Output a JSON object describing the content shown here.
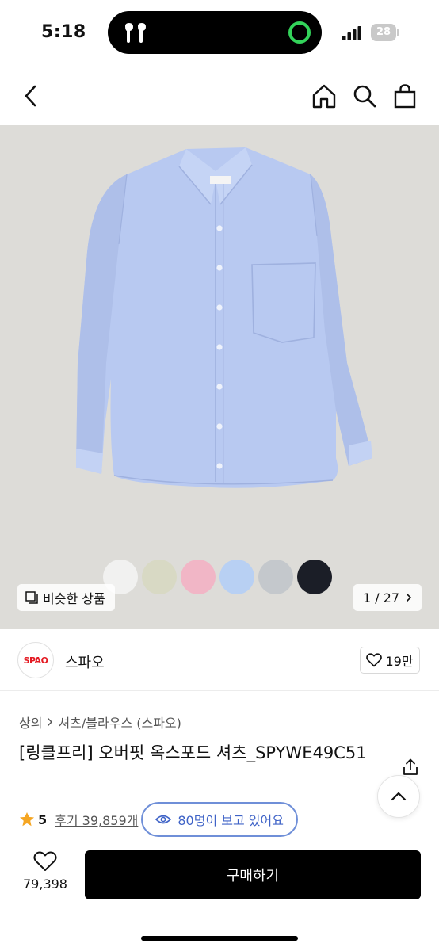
{
  "status_bar": {
    "time": "5:18",
    "battery": "28",
    "icons": [
      "airpods-icon",
      "green-ring-indicator",
      "signal-icon",
      "battery-icon"
    ]
  },
  "nav": {
    "icons": [
      "back-chevron-icon",
      "home-icon",
      "search-icon",
      "bag-icon"
    ]
  },
  "gallery": {
    "similar_label": "비슷한 상품",
    "page_indicator": "1 / 27",
    "swatches": [
      "#f1f1f0",
      "#d8d9c4",
      "#f1b6c6",
      "#b8d0f3",
      "#c4c8cc",
      "#1b1e27"
    ],
    "shirt_color": "#b8c9f1"
  },
  "brand": {
    "logo_text": "SPAO",
    "name": "스파오",
    "likes": "19만"
  },
  "product": {
    "breadcrumb": [
      "상의",
      "셔츠/블라우스 (스파오)"
    ],
    "title": "[링클프리] 오버핏 옥스포드 셔츠_SPYWE49C51",
    "rating": "5",
    "reviews": "후기 39,859개",
    "viewers": "80명이 보고 있어요"
  },
  "bottom": {
    "wish_count": "79,398",
    "buy_label": "구매하기"
  }
}
